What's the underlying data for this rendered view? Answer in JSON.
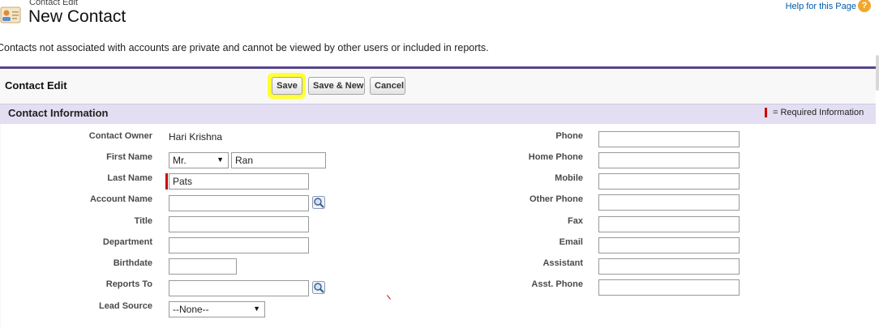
{
  "header": {
    "subtitle": "Contact Edit",
    "title": "New Contact",
    "help_link": "Help for this Page",
    "help_icon": "help-icon",
    "notice": "Contacts not associated with accounts are private and cannot be viewed by other users or included in reports."
  },
  "page_block": {
    "title": "Contact Edit",
    "buttons": {
      "save": "Save",
      "save_new": "Save & New",
      "cancel": "Cancel"
    },
    "highlight_color": "#ffff33",
    "accent_color": "#56458c"
  },
  "section": {
    "title": "Contact Information",
    "required_legend": "= Required Information",
    "required_color": "#cc0000"
  },
  "left_fields": {
    "contact_owner": {
      "label": "Contact Owner",
      "value": "Hari Krishna"
    },
    "first_name": {
      "label": "First Name",
      "salutation": "Mr.",
      "value": "Ran"
    },
    "last_name": {
      "label": "Last Name",
      "value": "Pats"
    },
    "account_name": {
      "label": "Account Name",
      "value": ""
    },
    "title": {
      "label": "Title",
      "value": ""
    },
    "department": {
      "label": "Department",
      "value": ""
    },
    "birthdate": {
      "label": "Birthdate",
      "value": ""
    },
    "reports_to": {
      "label": "Reports To",
      "value": ""
    },
    "lead_source": {
      "label": "Lead Source",
      "value": "--None--"
    }
  },
  "right_fields": {
    "phone": {
      "label": "Phone",
      "value": ""
    },
    "home_phone": {
      "label": "Home Phone",
      "value": ""
    },
    "mobile": {
      "label": "Mobile",
      "value": ""
    },
    "other_phone": {
      "label": "Other Phone",
      "value": ""
    },
    "fax": {
      "label": "Fax",
      "value": ""
    },
    "email": {
      "label": "Email",
      "value": ""
    },
    "assistant": {
      "label": "Assistant",
      "value": ""
    },
    "asst_phone": {
      "label": "Asst. Phone",
      "value": ""
    }
  },
  "icons": {
    "contact": "contact-card-icon",
    "lookup": "lookup-magnifier-icon",
    "dropdown": "chevron-down-icon"
  }
}
